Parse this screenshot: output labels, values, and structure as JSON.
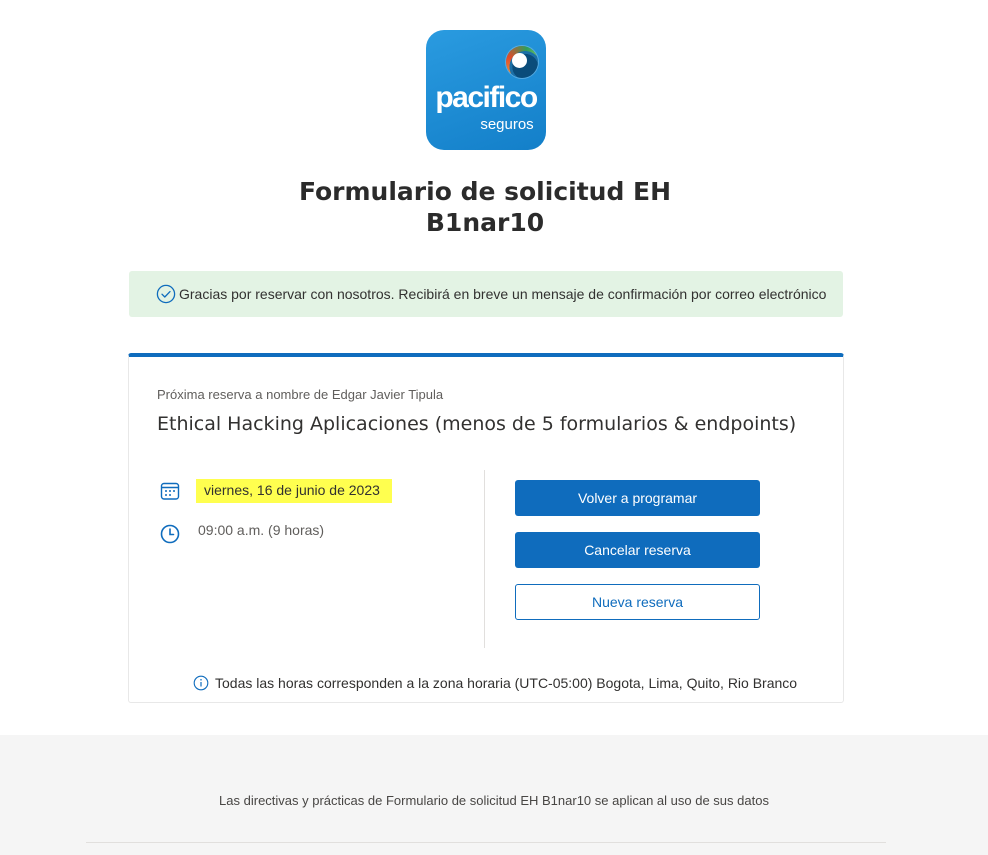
{
  "logo": {
    "word": "pacifico",
    "sub": "seguros",
    "brand_color": "#1e88d3"
  },
  "page": {
    "title": "Formulario de solicitud EH B1nar10"
  },
  "banner": {
    "icon": "check-circle-icon",
    "text": "Gracias por reservar con nosotros. Recibirá en breve un mensaje de confirmación por correo electrónico",
    "bg_color": "#e3f3e4"
  },
  "booking": {
    "booked_for": "Próxima reserva a nombre de Edgar Javier Tipula",
    "service": "Ethical Hacking Aplicaciones (menos de 5 formularios & endpoints)",
    "date_icon": "calendar-icon",
    "date": "viernes, 16 de junio de 2023",
    "highlight_color": "#ffff4f",
    "time_icon": "clock-icon",
    "time": "09:00 a.m. (9 horas)"
  },
  "actions": {
    "reschedule": "Volver a programar",
    "cancel": "Cancelar reserva",
    "new": "Nueva reserva",
    "accent_color": "#0f6cbd"
  },
  "timezone": {
    "icon": "info-icon",
    "text": "Todas las horas corresponden a la zona horaria (UTC-05:00) Bogota, Lima, Quito, Rio Branco"
  },
  "footer": {
    "text": "Las directivas y prácticas de Formulario de solicitud EH B1nar10 se aplican al uso de sus datos"
  }
}
